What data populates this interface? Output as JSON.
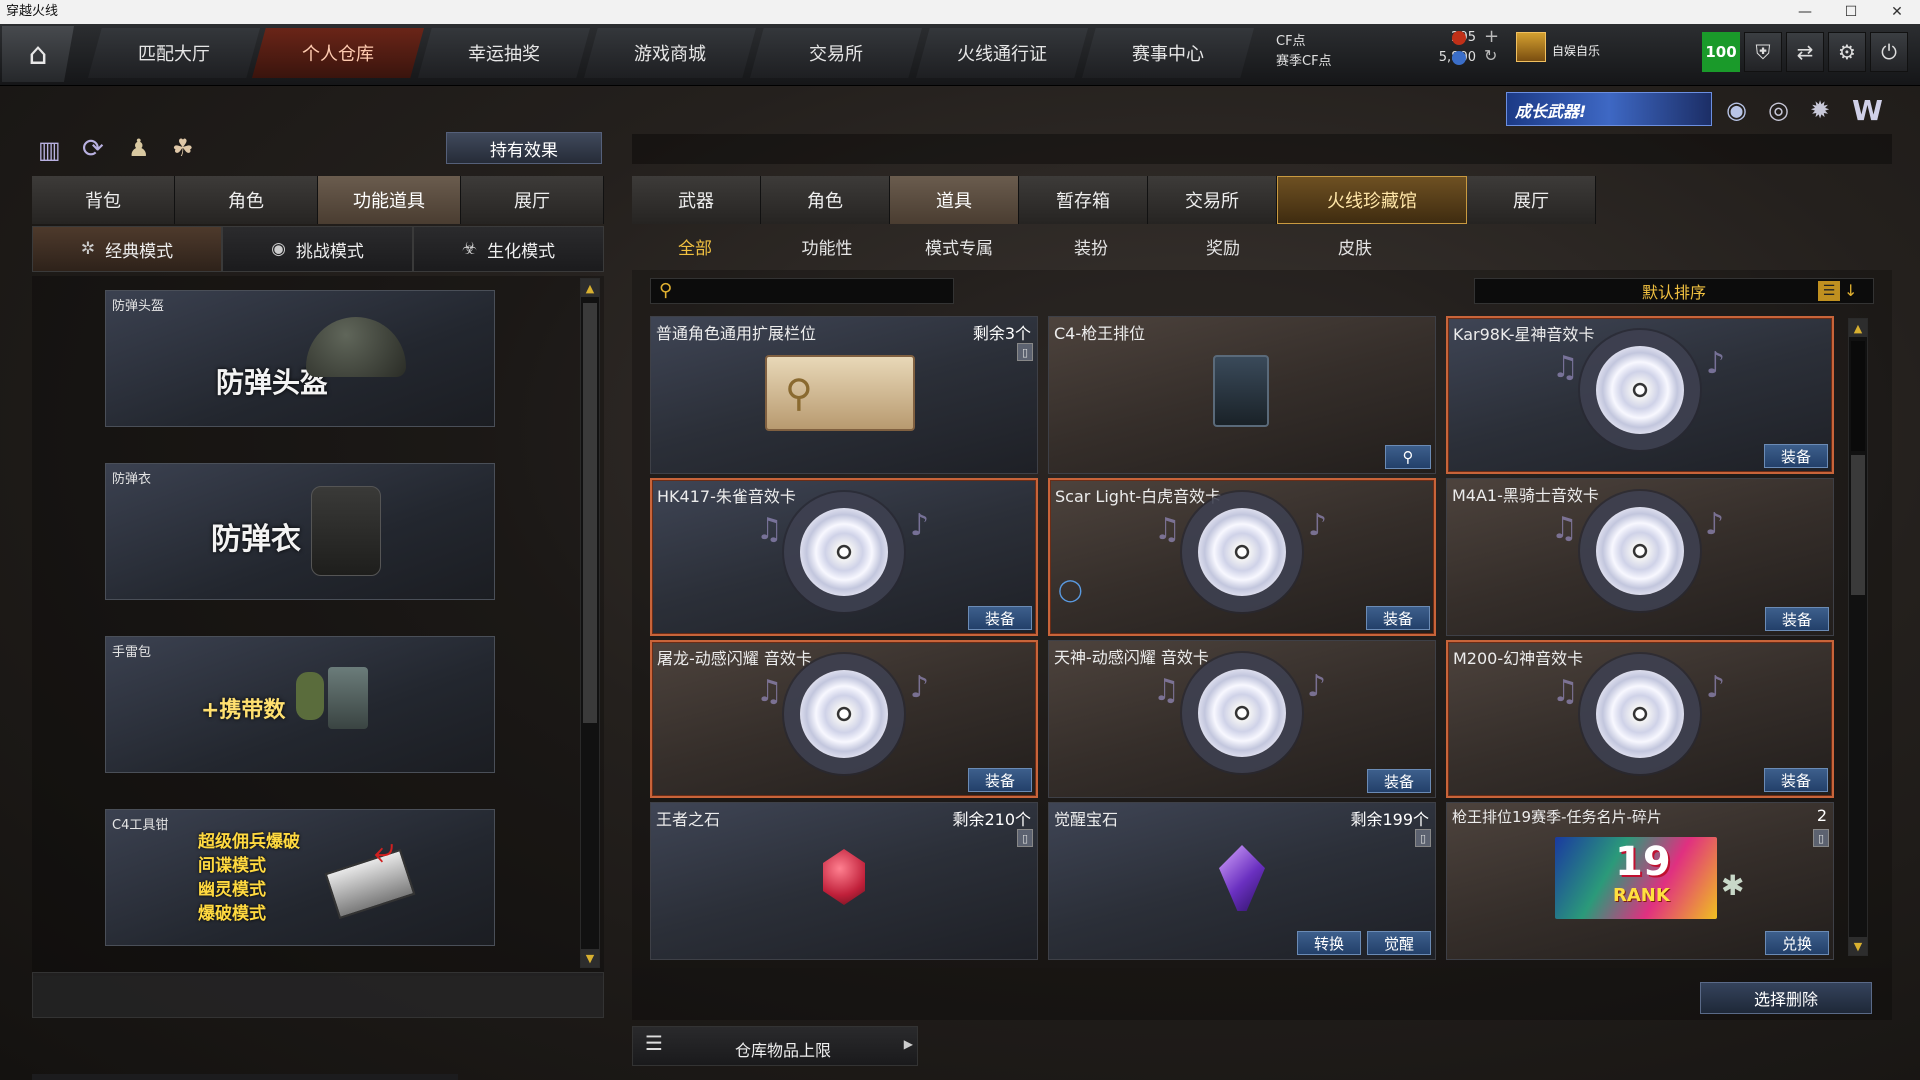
{
  "window": {
    "title": "穿越火线"
  },
  "nav": {
    "tabs": [
      "匹配大厅",
      "个人仓库",
      "幸运抽奖",
      "游戏商城",
      "交易所",
      "火线通行证",
      "赛事中心"
    ],
    "active": 1
  },
  "currency": {
    "cf_label": "CF点",
    "cf_value": "295",
    "season_label": "赛季CF点",
    "season_value": "5,800"
  },
  "user": {
    "name": "自娱自乐",
    "level": "100"
  },
  "banner": {
    "text": "成长武器!"
  },
  "left": {
    "effect_button": "持有效果",
    "tabs": [
      "背包",
      "角色",
      "功能道具",
      "展厅"
    ],
    "active_tab": 2,
    "modes": [
      "经典模式",
      "挑战模式",
      "生化模式"
    ],
    "active_mode": 0,
    "cards": [
      {
        "caption": "防弹头盔",
        "big": "防弹头盔"
      },
      {
        "caption": "防弹衣",
        "big": "防弹衣"
      },
      {
        "caption": "手雷包",
        "big": "+携带数"
      },
      {
        "caption": "C4工具钳",
        "lines": [
          "超级佣兵爆破",
          "间谍模式",
          "幽灵模式",
          "爆破模式"
        ]
      }
    ]
  },
  "right": {
    "tabs": [
      "武器",
      "角色",
      "道具",
      "暂存箱",
      "交易所",
      "火线珍藏馆",
      "展厅"
    ],
    "active_tab": 5,
    "subtabs": [
      "全部",
      "功能性",
      "模式专属",
      "装扮",
      "奖励",
      "皮肤"
    ],
    "active_subtab": 0,
    "search": {
      "placeholder": ""
    },
    "sort": {
      "label": "默认排序"
    },
    "items": [
      {
        "title": "普通角色通用扩展栏位",
        "right": "剩余3个",
        "type": "key"
      },
      {
        "title": "C4-枪王排位",
        "right": "",
        "type": "c4"
      },
      {
        "title": "Kar98K-星神音效卡",
        "right": "",
        "type": "disc",
        "btn": "装备"
      },
      {
        "title": "HK417-朱雀音效卡",
        "right": "",
        "type": "disc",
        "btn": "装备"
      },
      {
        "title": "Scar Light-白虎音效卡",
        "right": "",
        "type": "disc",
        "btn": "装备"
      },
      {
        "title": "M4A1-黑骑士音效卡",
        "right": "",
        "type": "disc",
        "btn": "装备"
      },
      {
        "title": "屠龙-动感闪耀 音效卡",
        "right": "",
        "type": "disc",
        "btn": "装备"
      },
      {
        "title": "天神-动感闪耀 音效卡",
        "right": "",
        "type": "disc",
        "btn": "装备"
      },
      {
        "title": "M200-幻神音效卡",
        "right": "",
        "type": "disc",
        "btn": "装备"
      },
      {
        "title": "王者之石",
        "right": "剩余210个",
        "type": "gem-red"
      },
      {
        "title": "觉醒宝石",
        "right": "剩余199个",
        "type": "gem-purple",
        "btns": [
          "转换",
          "觉醒"
        ]
      },
      {
        "title": "枪王排位19赛季-任务名片-碎片",
        "right": "2",
        "type": "rank",
        "btn": "兑换",
        "rank_text": "19",
        "rank_sub": "RANK"
      }
    ],
    "delete_button": "选择删除",
    "storage_label": "仓库物品上限"
  },
  "colors": {
    "accent": "#c8643a",
    "button_blue": "#2f5081",
    "gold": "#d8b030"
  }
}
